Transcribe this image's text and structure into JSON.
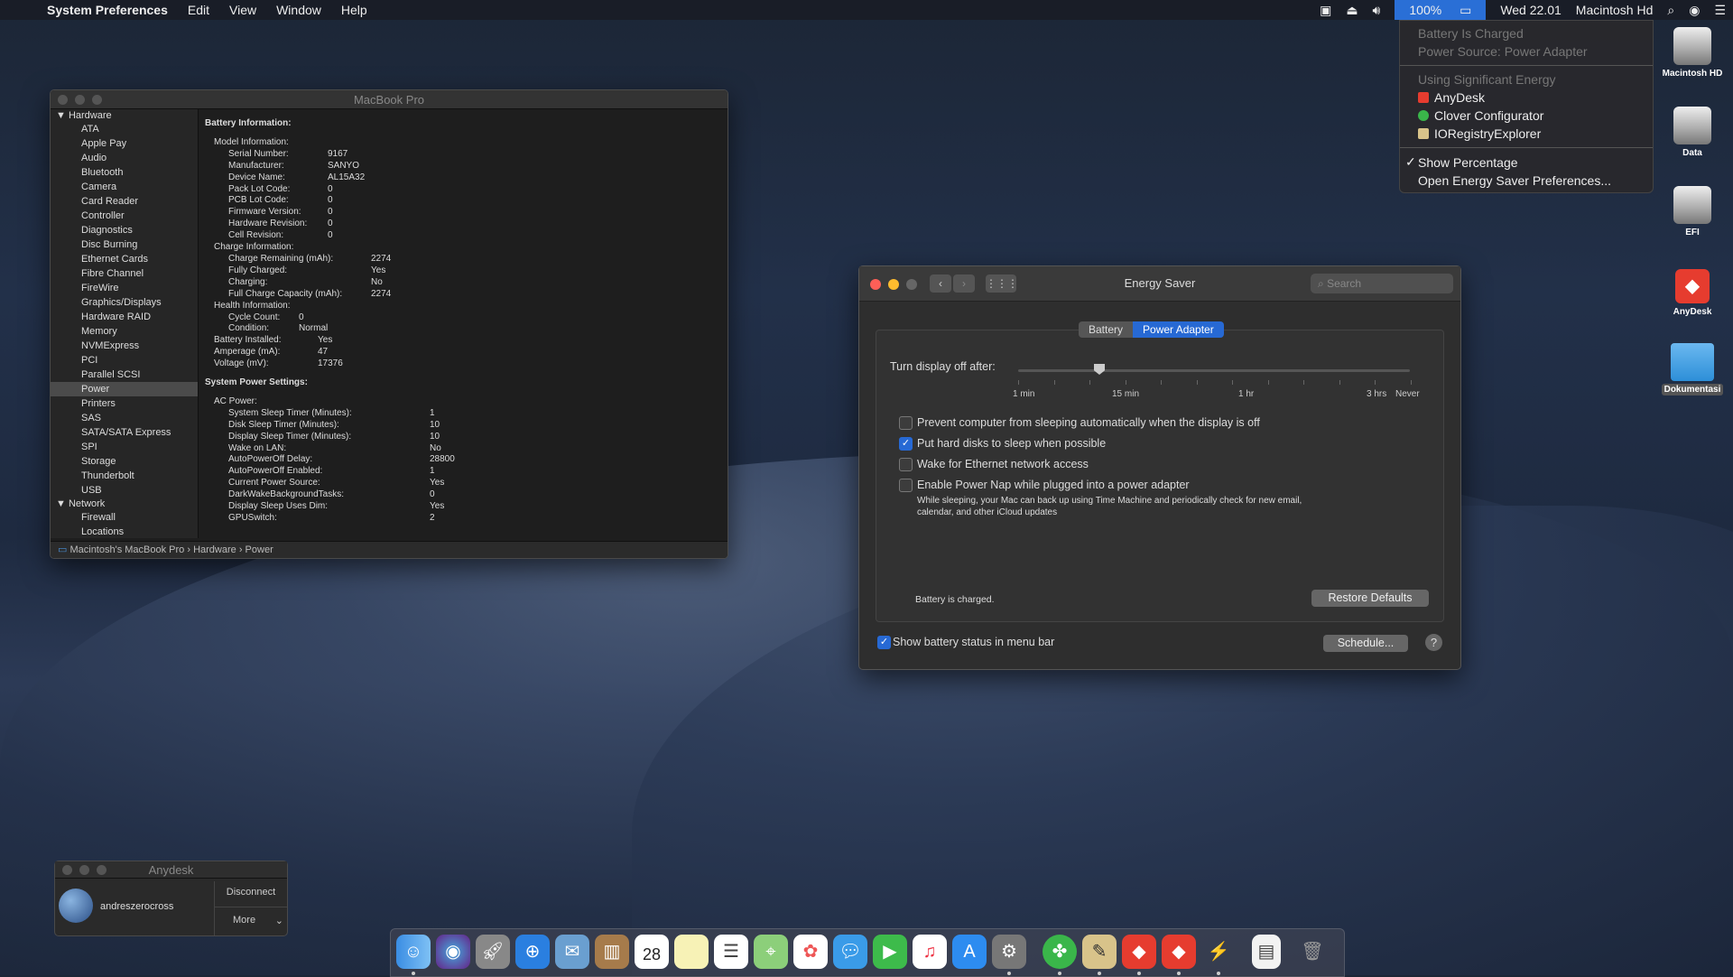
{
  "menubar": {
    "app": "System Preferences",
    "menus": [
      "Edit",
      "View",
      "Window",
      "Help"
    ],
    "battery": "100%",
    "clock": "Wed 22.01",
    "host": "Macintosh Hd"
  },
  "battery_menu": {
    "status1": "Battery Is Charged",
    "status2": "Power Source: Power Adapter",
    "energy_header": "Using Significant Energy",
    "apps": [
      {
        "name": "AnyDesk",
        "color": "#e63c2f"
      },
      {
        "name": "Clover Configurator",
        "color": "#3ab64a"
      },
      {
        "name": "IORegistryExplorer",
        "color": "#d8c38a"
      }
    ],
    "show_percentage": "Show Percentage",
    "open_prefs": "Open Energy Saver Preferences..."
  },
  "sysinfo": {
    "title": "MacBook Pro",
    "sidebar": {
      "hardware": "Hardware",
      "hardware_items": [
        "ATA",
        "Apple Pay",
        "Audio",
        "Bluetooth",
        "Camera",
        "Card Reader",
        "Controller",
        "Diagnostics",
        "Disc Burning",
        "Ethernet Cards",
        "Fibre Channel",
        "FireWire",
        "Graphics/Displays",
        "Hardware RAID",
        "Memory",
        "NVMExpress",
        "PCI",
        "Parallel SCSI",
        "Power",
        "Printers",
        "SAS",
        "SATA/SATA Express",
        "SPI",
        "Storage",
        "Thunderbolt",
        "USB"
      ],
      "network": "Network",
      "network_items": [
        "Firewall",
        "Locations"
      ],
      "selected": "Power"
    },
    "battery_info": "Battery Information:",
    "model_info": "Model Information:",
    "model": [
      [
        "Serial Number:",
        "9167"
      ],
      [
        "Manufacturer:",
        "SANYO"
      ],
      [
        "Device Name:",
        "AL15A32"
      ],
      [
        "Pack Lot Code:",
        "0"
      ],
      [
        "PCB Lot Code:",
        "0"
      ],
      [
        "Firmware Version:",
        "0"
      ],
      [
        "Hardware Revision:",
        "0"
      ],
      [
        "Cell Revision:",
        "0"
      ]
    ],
    "charge_info": "Charge Information:",
    "charge": [
      [
        "Charge Remaining (mAh):",
        "2274"
      ],
      [
        "Fully Charged:",
        "Yes"
      ],
      [
        "Charging:",
        "No"
      ],
      [
        "Full Charge Capacity (mAh):",
        "2274"
      ]
    ],
    "health_info": "Health Information:",
    "health": [
      [
        "Cycle Count:",
        "0"
      ],
      [
        "Condition:",
        "Normal"
      ]
    ],
    "battery_misc": [
      [
        "Battery Installed:",
        "Yes"
      ],
      [
        "Amperage (mA):",
        "47"
      ],
      [
        "Voltage (mV):",
        "17376"
      ]
    ],
    "power_settings": "System Power Settings:",
    "ac_power": "AC Power:",
    "ac": [
      [
        "System Sleep Timer (Minutes):",
        "1"
      ],
      [
        "Disk Sleep Timer (Minutes):",
        "10"
      ],
      [
        "Display Sleep Timer (Minutes):",
        "10"
      ],
      [
        "Wake on LAN:",
        "No"
      ],
      [
        "AutoPowerOff Delay:",
        "28800"
      ],
      [
        "AutoPowerOff Enabled:",
        "1"
      ],
      [
        "Current Power Source:",
        "Yes"
      ],
      [
        "DarkWakeBackgroundTasks:",
        "0"
      ],
      [
        "Display Sleep Uses Dim:",
        "Yes"
      ],
      [
        "GPUSwitch:",
        "2"
      ]
    ],
    "path": [
      "Macintosh's MacBook Pro",
      "Hardware",
      "Power"
    ]
  },
  "energy_saver": {
    "title": "Energy Saver",
    "search_placeholder": "Search",
    "tabs": [
      "Battery",
      "Power Adapter"
    ],
    "active_tab": "Power Adapter",
    "slider_label": "Turn display off after:",
    "slider_ticks": [
      "1 min",
      "15 min",
      "1 hr",
      "3 hrs",
      "Never"
    ],
    "slider_value": "10 min",
    "options": [
      {
        "label": "Prevent computer from sleeping automatically when the display is off",
        "checked": false
      },
      {
        "label": "Put hard disks to sleep when possible",
        "checked": true
      },
      {
        "label": "Wake for Ethernet network access",
        "checked": false
      },
      {
        "label": "Enable Power Nap while plugged into a power adapter",
        "checked": false
      }
    ],
    "power_nap_desc1": "While sleeping, your Mac can back up using Time Machine and periodically check for new email,",
    "power_nap_desc2": "calendar, and other iCloud updates",
    "battery_status": "Battery is charged.",
    "restore": "Restore Defaults",
    "show_status": "Show battery status in menu bar",
    "schedule": "Schedule...",
    "help": "?"
  },
  "anydesk": {
    "title": "Anydesk",
    "user": "andreszerocross",
    "disconnect": "Disconnect",
    "more": "More"
  },
  "desktop": [
    "Macintosh HD",
    "Data",
    "EFI",
    "AnyDesk",
    "Dokumentasi"
  ],
  "dock_day": "28",
  "dock_month": "AUG",
  "colors": {
    "accent": "#2769d4",
    "anydesk": "#e63c2f"
  }
}
